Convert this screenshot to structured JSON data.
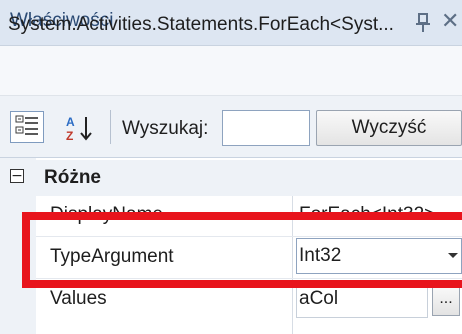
{
  "window": {
    "title": "Właściwości",
    "close_glyph": "✕"
  },
  "object_type": "System.Activities.Statements.ForEach<Syst...",
  "toolbar": {
    "search_label": "Wyszukaj:",
    "search_value": "",
    "clear_label": "Wyczyść"
  },
  "grid": {
    "section": {
      "expander": "−",
      "label": "Różne"
    },
    "properties": [
      {
        "name": "DisplayName",
        "value": "ForEach<Int32>"
      },
      {
        "name": "TypeArgument",
        "value": "Int32"
      },
      {
        "name": "Values",
        "value": "aCol"
      }
    ],
    "ellipsis_label": "..."
  },
  "colors": {
    "highlight": "#e8141c",
    "title_text": "#2b4a74",
    "title_bar": "#dde6f2"
  }
}
